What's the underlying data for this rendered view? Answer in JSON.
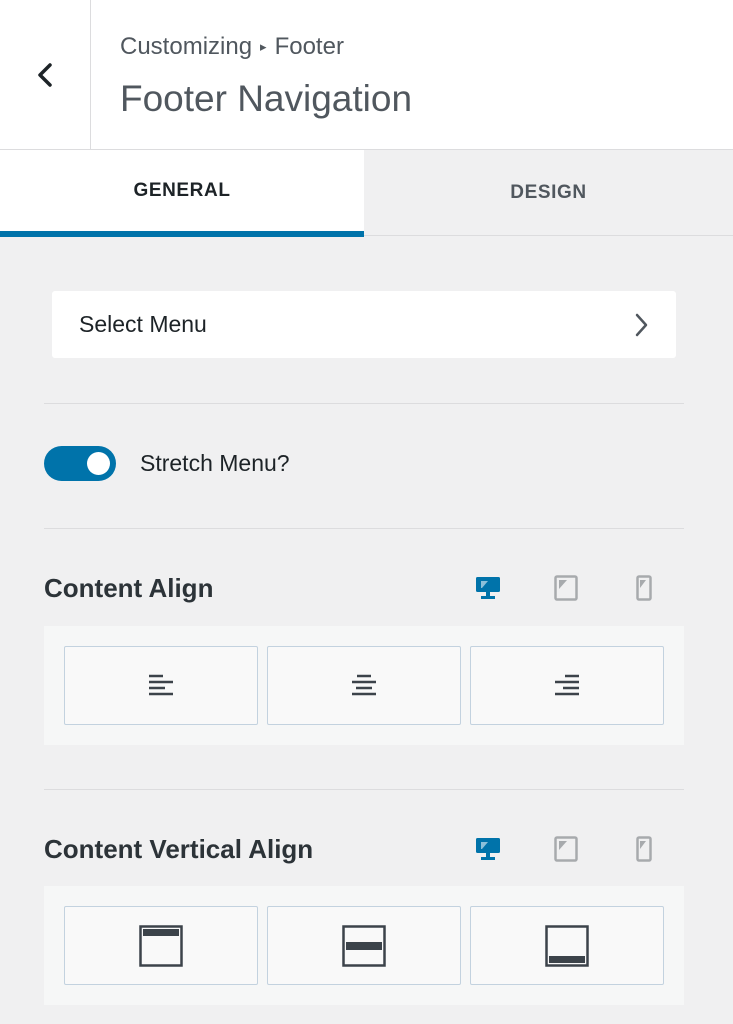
{
  "header": {
    "back_icon": "chevron-left-icon",
    "breadcrumb": {
      "parent": "Customizing",
      "separator": "▸",
      "current": "Footer"
    },
    "title": "Footer Navigation"
  },
  "tabs": [
    {
      "label": "GENERAL",
      "active": true
    },
    {
      "label": "DESIGN",
      "active": false
    }
  ],
  "select_menu": {
    "label": "Select Menu",
    "icon": "chevron-right-icon"
  },
  "stretch_menu": {
    "label": "Stretch Menu?",
    "enabled": true
  },
  "content_align": {
    "title": "Content Align",
    "devices": [
      "desktop-icon",
      "tablet-icon",
      "mobile-icon"
    ],
    "active_device": "desktop",
    "options": [
      "align-left-icon",
      "align-center-icon",
      "align-right-icon"
    ]
  },
  "content_vertical_align": {
    "title": "Content Vertical Align",
    "devices": [
      "desktop-icon",
      "tablet-icon",
      "mobile-icon"
    ],
    "active_device": "desktop",
    "options": [
      "align-top-icon",
      "align-middle-icon",
      "align-bottom-icon"
    ]
  },
  "colors": {
    "accent": "#0073aa",
    "device_inactive": "#a7aaad",
    "icon": "#3c434a"
  }
}
